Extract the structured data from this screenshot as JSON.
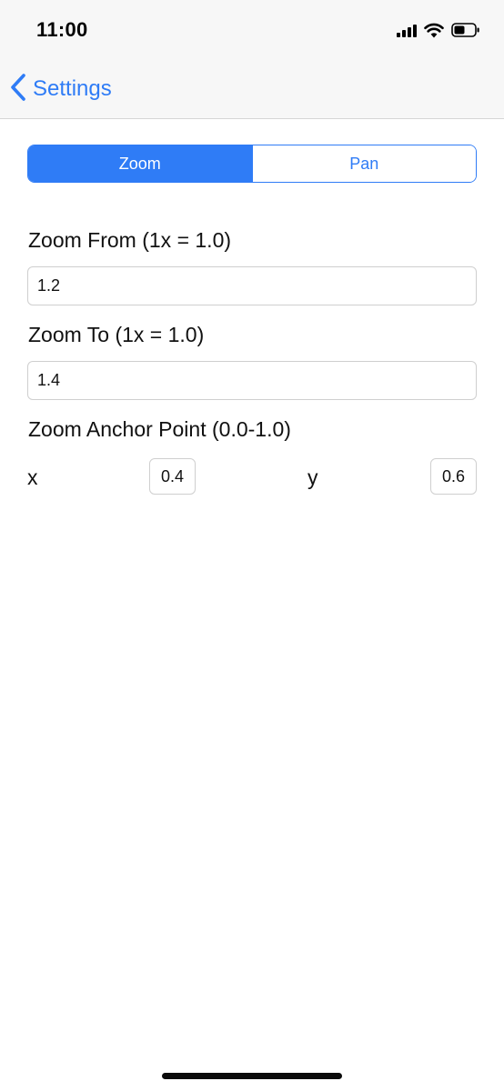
{
  "status_bar": {
    "time": "11:00",
    "icons": [
      "signal-icon",
      "wifi-icon",
      "battery-icon"
    ]
  },
  "nav": {
    "back_label": "Settings",
    "back_icon": "chevron-left-icon"
  },
  "segmented_control": {
    "segments": [
      {
        "label": "Zoom",
        "selected": true
      },
      {
        "label": "Pan",
        "selected": false
      }
    ]
  },
  "form": {
    "zoom_from": {
      "label": "Zoom From (1x = 1.0)",
      "value": "1.2"
    },
    "zoom_to": {
      "label": "Zoom To (1x = 1.0)",
      "value": "1.4"
    },
    "anchor": {
      "label": "Zoom Anchor Point (0.0-1.0)",
      "x_label": "x",
      "x_value": "0.4",
      "y_label": "y",
      "y_value": "0.6"
    }
  },
  "colors": {
    "accent": "#2f7cf6",
    "bar_background": "#f7f7f7",
    "field_border": "#cfcfcf"
  }
}
